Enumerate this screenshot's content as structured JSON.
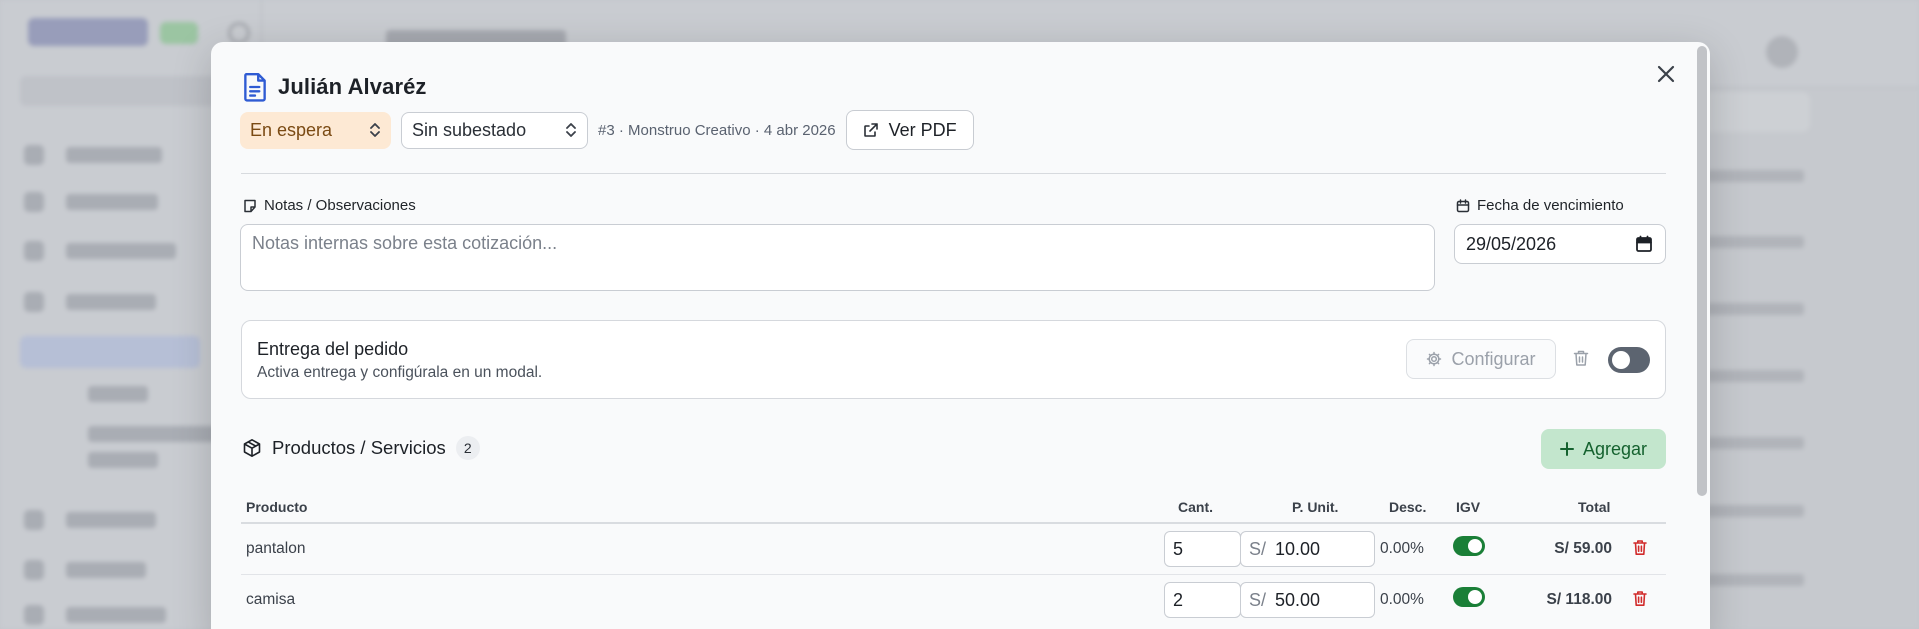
{
  "modal": {
    "title": "Julián Alvaréz",
    "status": "En espera",
    "substatus": "Sin subestado",
    "meta": "#3 · Monstruo Creativo · 4 abr 2026",
    "pdf_label": "Ver PDF"
  },
  "notes": {
    "label": "Notas / Observaciones",
    "placeholder": "Notas internas sobre esta cotización..."
  },
  "due": {
    "label": "Fecha de vencimiento",
    "value": "29/05/2026"
  },
  "delivery": {
    "title": "Entrega del pedido",
    "subtitle": "Activa entrega y configúrala en un modal.",
    "configure_label": "Configurar",
    "enabled": false
  },
  "products": {
    "title": "Productos / Servicios",
    "count": "2",
    "add_label": "Agregar",
    "columns": {
      "product": "Producto",
      "qty": "Cant.",
      "unit_price": "P. Unit.",
      "discount": "Desc.",
      "igv": "IGV",
      "total": "Total"
    },
    "currency": "S/",
    "rows": [
      {
        "name": "pantalon",
        "qty": "5",
        "unit_price": "10.00",
        "discount": "0.00%",
        "igv": true,
        "total": "S/ 59.00"
      },
      {
        "name": "camisa",
        "qty": "2",
        "unit_price": "50.00",
        "discount": "0.00%",
        "igv": true,
        "total": "S/ 118.00"
      }
    ]
  },
  "colors": {
    "status_bg": "#fde9d4",
    "add_button_bg": "#c3e6cd",
    "toggle_on": "#1a7f37",
    "danger": "#d12b2b",
    "doc_icon": "#2f5bd3"
  },
  "icons": {
    "header": "document-icon",
    "close": "close-icon",
    "pdf": "external-link-icon",
    "notes": "note-icon",
    "due": "calendar-icon",
    "configure": "gear-icon",
    "delete": "trash-icon",
    "products": "package-icon",
    "add": "plus-icon"
  }
}
